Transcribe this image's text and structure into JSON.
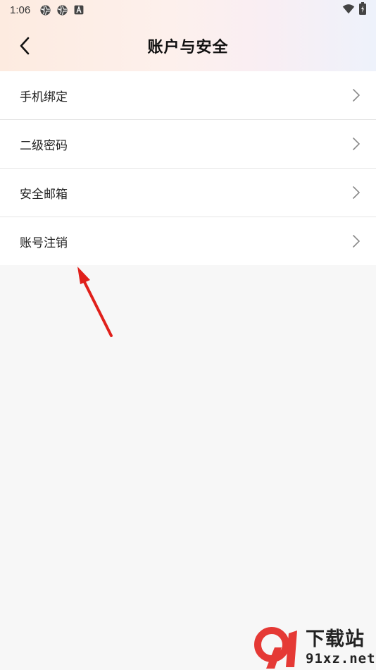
{
  "status_bar": {
    "time": "1:06",
    "left_icons": [
      "aperture-icon",
      "aperture-icon",
      "a-square-icon"
    ],
    "right_icons": [
      "wifi-icon",
      "battery-charging-icon"
    ]
  },
  "header": {
    "title": "账户与安全",
    "back_icon": "chevron-left-icon"
  },
  "menu": {
    "items": [
      {
        "label": "手机绑定"
      },
      {
        "label": "二级密码"
      },
      {
        "label": "安全邮箱"
      },
      {
        "label": "账号注销"
      }
    ]
  },
  "annotation": {
    "color": "#e0201b"
  },
  "watermark": {
    "text_cn": "下载站",
    "domain": "91xz.net"
  },
  "colors": {
    "background": "#f7f7f7",
    "card": "#ffffff",
    "divider": "#e6e6e6",
    "watermark_red": "#e53935"
  }
}
